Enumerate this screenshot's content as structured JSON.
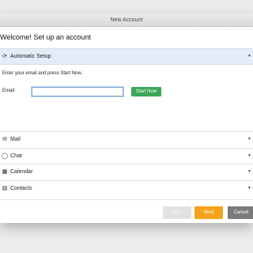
{
  "window": {
    "title": "New Account"
  },
  "welcome": "Welcome! Set up an account",
  "sections": [
    {
      "label": "Automatic Setup",
      "icon": "refresh-icon",
      "glyph": "⟳",
      "expanded": true
    },
    {
      "label": "Mail",
      "icon": "mail-icon",
      "glyph": "✉",
      "expanded": false
    },
    {
      "label": "Chat",
      "icon": "chat-icon",
      "glyph": "◯",
      "expanded": false
    },
    {
      "label": "Calendar",
      "icon": "calendar-icon",
      "glyph": "▦",
      "expanded": false
    },
    {
      "label": "Contacts",
      "icon": "contacts-icon",
      "glyph": "▤",
      "expanded": false
    }
  ],
  "auto_setup": {
    "instruction": "Enter your email and press Start Now.",
    "email_label": "Email:",
    "email_value": "",
    "start_label": "Start Now"
  },
  "footer": {
    "back_label": "Back",
    "next_label": "Next",
    "cancel_label": "Cancel"
  },
  "colors": {
    "active_section_bg": "#e3edf7",
    "start_button": "#3aa757",
    "next_button": "#f5a31a",
    "cancel_button": "#7b7b7b",
    "back_button_disabled": "#e2e2e2"
  }
}
